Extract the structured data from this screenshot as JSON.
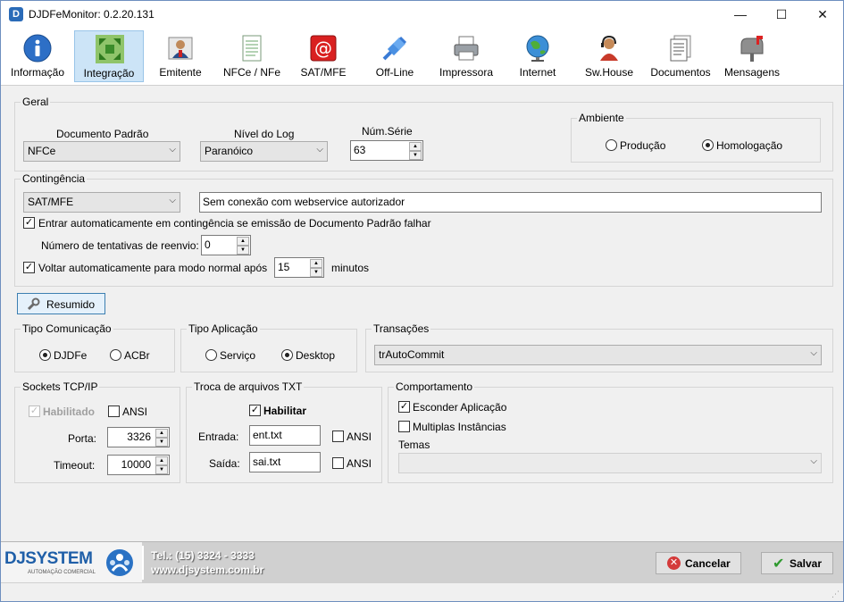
{
  "window": {
    "title": "DJDFeMonitor: 0.2.20.131",
    "controls": {
      "minimize": "—",
      "maximize": "☐",
      "close": "✕"
    }
  },
  "toolbar": {
    "items": [
      {
        "label": "Informação",
        "icon": "info-icon"
      },
      {
        "label": "Integração",
        "icon": "integration-icon"
      },
      {
        "label": "Emitente",
        "icon": "user-card-icon"
      },
      {
        "label": "NFCe / NFe",
        "icon": "document-icon"
      },
      {
        "label": "SAT/MFE",
        "icon": "at-icon"
      },
      {
        "label": "Off-Line",
        "icon": "plug-icon"
      },
      {
        "label": "Impressora",
        "icon": "printer-icon"
      },
      {
        "label": "Internet",
        "icon": "globe-icon"
      },
      {
        "label": "Sw.House",
        "icon": "headset-icon"
      },
      {
        "label": "Documentos",
        "icon": "documents-icon"
      },
      {
        "label": "Mensagens",
        "icon": "mailbox-icon"
      }
    ],
    "active": "Integração"
  },
  "geral": {
    "legend": "Geral",
    "documento_padrao": {
      "label": "Documento Padrão",
      "value": "NFCe"
    },
    "nivel_log": {
      "label": "Nível do Log",
      "value": "Paranóico"
    },
    "num_serie": {
      "label": "Núm.Série",
      "value": "63"
    },
    "ambiente": {
      "legend": "Ambiente",
      "producao": "Produção",
      "homologacao": "Homologação",
      "selected": "Homologação"
    }
  },
  "contingencia": {
    "legend": "Contingência",
    "tipo": "SAT/MFE",
    "motivo": "Sem conexão com webservice autorizador",
    "auto_entrar": {
      "label": "Entrar automaticamente em contingência se emissão de Documento Padrão falhar",
      "checked": true
    },
    "tentativas": {
      "label": "Número de tentativas de reenvio:",
      "value": "0"
    },
    "auto_voltar": {
      "label": "Voltar automaticamente para modo normal após",
      "checked": true,
      "value": "15",
      "unit": "minutos"
    }
  },
  "resumido_button": "Resumido",
  "tipo_comunicacao": {
    "legend": "Tipo Comunicação",
    "opt1": "DJDFe",
    "opt2": "ACBr",
    "selected": "DJDFe"
  },
  "tipo_aplicacao": {
    "legend": "Tipo Aplicação",
    "opt1": "Serviço",
    "opt2": "Desktop",
    "selected": "Desktop"
  },
  "transacoes": {
    "legend": "Transações",
    "value": "trAutoCommit"
  },
  "sockets": {
    "legend": "Sockets TCP/IP",
    "habilitado": "Habilitado",
    "ansi": "ANSI",
    "porta": {
      "label": "Porta:",
      "value": "3326"
    },
    "timeout": {
      "label": "Timeout:",
      "value": "10000"
    }
  },
  "troca_txt": {
    "legend": "Troca de arquivos TXT",
    "habilitar": "Habilitar",
    "entrada": {
      "label": "Entrada:",
      "value": "ent.txt"
    },
    "saida": {
      "label": "Saída:",
      "value": "sai.txt"
    },
    "ansi": "ANSI"
  },
  "comportamento": {
    "legend": "Comportamento",
    "esconder": "Esconder Aplicação",
    "multiplas": "Multiplas Instâncias",
    "temas": "Temas",
    "temas_value": ""
  },
  "footer": {
    "logo_text": "DJSYSTEM",
    "logo_sub": "AUTOMAÇÃO COMERCIAL",
    "phone": "Tel.: (15) 3324 - 3333",
    "site": "www.djsystem.com.br",
    "cancelar": "Cancelar",
    "salvar": "Salvar"
  },
  "colors": {
    "accent": "#cce4f7",
    "brand_blue": "#1f5fa8",
    "brand_red": "#cc2222"
  }
}
